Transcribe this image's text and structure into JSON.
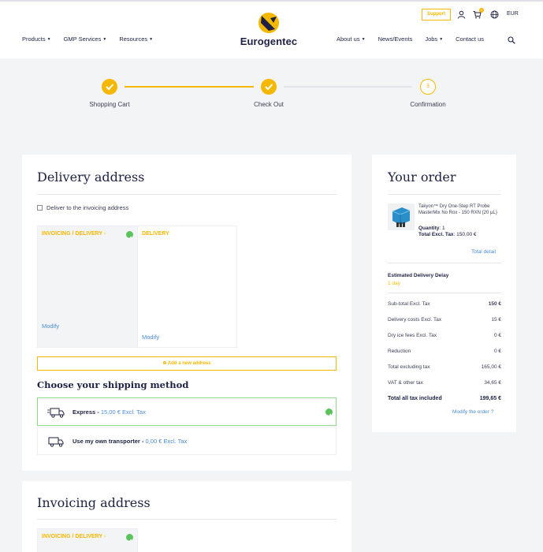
{
  "header": {
    "brand": "Eurogentec",
    "nav_left": [
      "Products",
      "GMP Services",
      "Resources"
    ],
    "nav_right": [
      "About us",
      "News/Events",
      "Jobs",
      "Contact us"
    ],
    "support_label": "Support",
    "cart_count": "1",
    "currency": "EUR",
    "colors": {
      "accent": "#f5b800",
      "navy": "#1e2144",
      "link": "#4a8cd6",
      "success": "#5cc35c"
    }
  },
  "stepper": {
    "steps": [
      {
        "label": "Shopping Cart",
        "state": "done"
      },
      {
        "label": "Check Out",
        "state": "done"
      },
      {
        "label": "Confirmation",
        "state": "todo",
        "number": "3"
      }
    ]
  },
  "delivery": {
    "title": "Delivery address",
    "checkbox_label": "Deliver to the invoicing address",
    "boxes": [
      {
        "title": "INVOICING / DELIVERY -",
        "modify": "Modify"
      },
      {
        "title": "DELIVERY",
        "modify": "Modify"
      }
    ],
    "add_address": "⊕ Add a new address",
    "shipping_title": "Choose your shipping method",
    "shipping": [
      {
        "name": "Express -",
        "price": "15,00 € Excl. Tax"
      },
      {
        "name": "Use my own transporter -",
        "price": "0,00 € Excl. Tax"
      }
    ]
  },
  "invoicing": {
    "title": "Invoicing address",
    "box_title": "INVOICING / DELIVERY -"
  },
  "order": {
    "title": "Your order",
    "product_name": "Takyon™ Dry One-Step RT Probe MasterMix No Rox - 150 RXN (20 µL)",
    "quantity_label": "Quantity",
    "quantity": ": 1",
    "total_excl_label": "Total Excl. Tax",
    "total_excl": ": 150,00 €",
    "total_detail": "Total detail",
    "delivery_delay_label": "Estimated Delivery Delay",
    "delivery_delay": "1 day",
    "rows": [
      {
        "label": "Sub-total Excl. Tax",
        "value": "150 €"
      },
      {
        "label": "Delivery costs Excl. Tax",
        "value": "15 €"
      },
      {
        "label": "Dry ice fees Excl. Tax",
        "value": "0 €"
      },
      {
        "label": "Reduction",
        "value": "0 €"
      },
      {
        "label": "Total excluding tax",
        "value": "165,00 €"
      },
      {
        "label": "VAT & other tax",
        "value": "34,65 €"
      },
      {
        "label": "Total all tax included",
        "value": "199,65 €"
      }
    ],
    "modify_order": "Modify the order ?"
  }
}
